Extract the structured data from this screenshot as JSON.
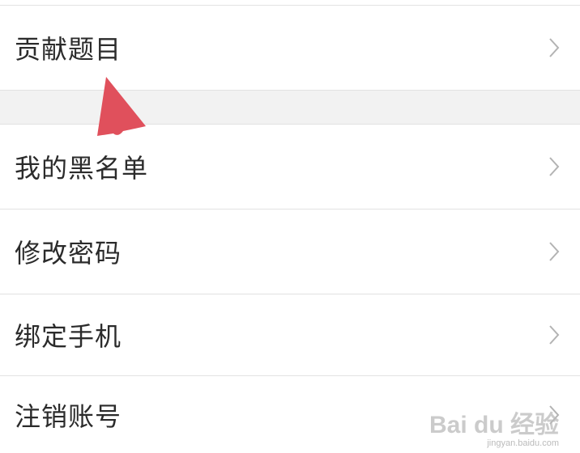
{
  "settings_list": {
    "items": [
      {
        "label": "贡献题目"
      },
      {
        "label": "我的黑名单"
      },
      {
        "label": "修改密码"
      },
      {
        "label": "绑定手机"
      },
      {
        "label": "注销账号"
      }
    ]
  },
  "chevron_icon": "chevron-right-icon",
  "annotation": {
    "color": "#e0505c",
    "icon": "pointer-arrow-icon"
  },
  "watermark": {
    "main": "Bai du 经验",
    "sub": "jingyan.baidu.com"
  }
}
